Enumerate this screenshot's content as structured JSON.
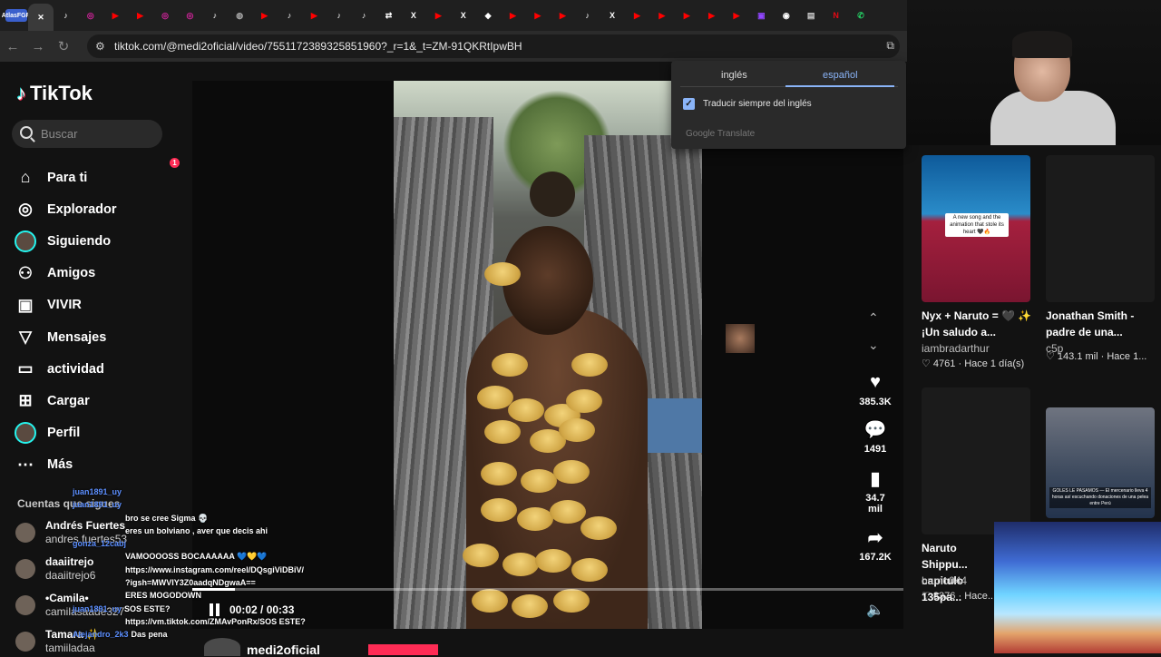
{
  "browser": {
    "tabs": [
      {
        "icon": "app-icon",
        "color": "#3a5fcc",
        "label": "AtlasFGR"
      },
      {
        "icon": "close-icon",
        "color": "#ffffff",
        "label": "✕"
      },
      {
        "icon": "tiktok-icon",
        "color": "#ffffff",
        "label": "♪"
      },
      {
        "icon": "instagram-icon",
        "color": "#d6249f",
        "label": "◎"
      },
      {
        "icon": "youtube-icon",
        "color": "#ff0000",
        "label": "▶"
      },
      {
        "icon": "youtube-icon",
        "color": "#ff0000",
        "label": "▶"
      },
      {
        "icon": "instagram-icon",
        "color": "#d6249f",
        "label": "◎"
      },
      {
        "icon": "instagram-icon",
        "color": "#d6249f",
        "label": "◎"
      },
      {
        "icon": "tiktok-icon",
        "color": "#ffffff",
        "label": "♪"
      },
      {
        "icon": "globe-icon",
        "color": "#aaaaaa",
        "label": "◍"
      },
      {
        "icon": "youtube-icon",
        "color": "#ff0000",
        "label": "▶"
      },
      {
        "icon": "tiktok-icon",
        "color": "#ffffff",
        "label": "♪"
      },
      {
        "icon": "youtube-icon",
        "color": "#ff0000",
        "label": "▶"
      },
      {
        "icon": "tiktok-icon",
        "color": "#ffffff",
        "label": "♪"
      },
      {
        "icon": "tiktok-icon",
        "color": "#ffffff",
        "label": "♪"
      },
      {
        "icon": "translate-icon",
        "color": "#ffffff",
        "label": "⇄"
      },
      {
        "icon": "x-icon",
        "color": "#ffffff",
        "label": "X"
      },
      {
        "icon": "youtube-icon",
        "color": "#ff0000",
        "label": "▶"
      },
      {
        "icon": "x-icon",
        "color": "#ffffff",
        "label": "X"
      },
      {
        "icon": "diamond-icon",
        "color": "#ffffff",
        "label": "◆"
      },
      {
        "icon": "youtube-icon",
        "color": "#ff0000",
        "label": "▶"
      },
      {
        "icon": "youtube-icon",
        "color": "#ff0000",
        "label": "▶"
      },
      {
        "icon": "youtube-icon",
        "color": "#ff0000",
        "label": "▶"
      },
      {
        "icon": "tiktok-icon",
        "color": "#ffffff",
        "label": "♪"
      },
      {
        "icon": "x-icon",
        "color": "#ffffff",
        "label": "X"
      },
      {
        "icon": "youtube-icon",
        "color": "#ff0000",
        "label": "▶"
      },
      {
        "icon": "youtube-icon",
        "color": "#ff0000",
        "label": "▶"
      },
      {
        "icon": "youtube-icon",
        "color": "#ff0000",
        "label": "▶"
      },
      {
        "icon": "youtube-icon",
        "color": "#ff0000",
        "label": "▶"
      },
      {
        "icon": "youtube-icon",
        "color": "#ff0000",
        "label": "▶"
      },
      {
        "icon": "twitch-icon",
        "color": "#9146ff",
        "label": "▣"
      },
      {
        "icon": "record-icon",
        "color": "#ffffff",
        "label": "◉"
      },
      {
        "icon": "news-icon",
        "color": "#cccccc",
        "label": "▤"
      },
      {
        "icon": "netflix-icon",
        "color": "#e50914",
        "label": "N"
      },
      {
        "icon": "whatsapp-icon",
        "color": "#25d366",
        "label": "✆"
      }
    ],
    "url": "tiktok.com/@medi2oficial/video/7551172389325851960?_r=1&_t=ZM-91QKRtIpwBH"
  },
  "translate_popup": {
    "tab_english": "inglés",
    "tab_spanish": "español",
    "checkbox_label": "Traducir siempre del inglés",
    "footer": "Google Translate"
  },
  "sidebar": {
    "logo": "TikTok",
    "search_placeholder": "Buscar",
    "nav": [
      {
        "label": "Para ti",
        "icon": "home-icon",
        "glyph": "⌂"
      },
      {
        "label": "Explorador",
        "icon": "compass-icon",
        "glyph": "◎"
      },
      {
        "label": "Siguiendo",
        "icon": "following-avatar-icon",
        "glyph": "●"
      },
      {
        "label": "Amigos",
        "icon": "friends-icon",
        "glyph": "⚇"
      },
      {
        "label": "VIVIR",
        "icon": "live-icon",
        "glyph": "▣"
      },
      {
        "label": "Mensajes",
        "icon": "messages-icon",
        "glyph": "▽"
      },
      {
        "label": "actividad",
        "icon": "activity-icon",
        "glyph": "▭",
        "badge": "1"
      },
      {
        "label": "Cargar",
        "icon": "upload-icon",
        "glyph": "⊞"
      },
      {
        "label": "Perfil",
        "icon": "profile-avatar-icon",
        "glyph": "●"
      },
      {
        "label": "Más",
        "icon": "more-icon",
        "glyph": "⋯"
      }
    ],
    "following_title": "Cuentas que sigues",
    "accounts": [
      {
        "name": "Andrés Fuertes",
        "handle": "andres.fuertes53"
      },
      {
        "name": "daaiitrejo",
        "handle": "daaiitrejo6"
      },
      {
        "name": "•Camila•",
        "handle": "camilasaade327"
      },
      {
        "name": "Tamara ✨",
        "handle": "tamiiladaa"
      }
    ]
  },
  "chat": [
    {
      "user": "juan1891_uy",
      "text": ""
    },
    {
      "user": "juan1891_uy",
      "text": ""
    },
    {
      "user": "",
      "text": "bro se cree Sigma 💀"
    },
    {
      "user": "",
      "text": "eres un bolviano , aver que decis ahi"
    },
    {
      "user": "gonza_12cabj",
      "text": ""
    },
    {
      "user": "",
      "text": "VAMOOOOSS BOCAAAAAA 💙💛💙"
    },
    {
      "user": "",
      "text": "https://www.instagram.com/reel/DQsgiViDBiV/"
    },
    {
      "user": "",
      "text": "?igsh=MWVIY3Z0aadqNDgwaA=="
    },
    {
      "user": "",
      "text": "ERES MOGODOWN"
    },
    {
      "user": "juan1891_uy",
      "text": "SOS ESTE?"
    },
    {
      "user": "",
      "text": "https://vm.tiktok.com/ZMAvPonRx/SOS ESTE?"
    },
    {
      "user": "Alejandro_2k3",
      "text": "Das pena"
    }
  ],
  "player": {
    "time": "00:02 / 00:33",
    "progress": 0.06,
    "author": "medi2oficial"
  },
  "actions": [
    {
      "icon": "heart-icon",
      "glyph": "♥",
      "count": "385.3K"
    },
    {
      "icon": "comment-icon",
      "glyph": "💬",
      "count": "1491"
    },
    {
      "icon": "bookmark-icon",
      "glyph": "▮",
      "count": "34.7\nmil"
    },
    {
      "icon": "share-icon",
      "glyph": "➦",
      "count": "167.2K"
    }
  ],
  "recommendations": [
    {
      "title": "Nyx + Naruto = 🖤 ✨ ¡Un saludo a...",
      "author": "iambradarthur",
      "likes": "4761",
      "time": "Hace 1 día(s)",
      "thumb_caption": "A new song and the animation that stole its heart 🖤🔥"
    },
    {
      "title": "Jonathan Smith - padre de una...",
      "author": "c5p",
      "likes": "143.1 mil",
      "time": "Hace 1..."
    },
    {
      "title": "Naruto Shippu... capitulo 135pa...",
      "author": "humo044",
      "likes": "8376",
      "time": "Hace..."
    },
    {
      "title": "",
      "author": "",
      "likes": "",
      "time": "",
      "thumb_caption": "GOLES LE PASAMOS — El mercenario lleva 4 horas así escuchando donaciones de una pelea entre Perú"
    }
  ]
}
